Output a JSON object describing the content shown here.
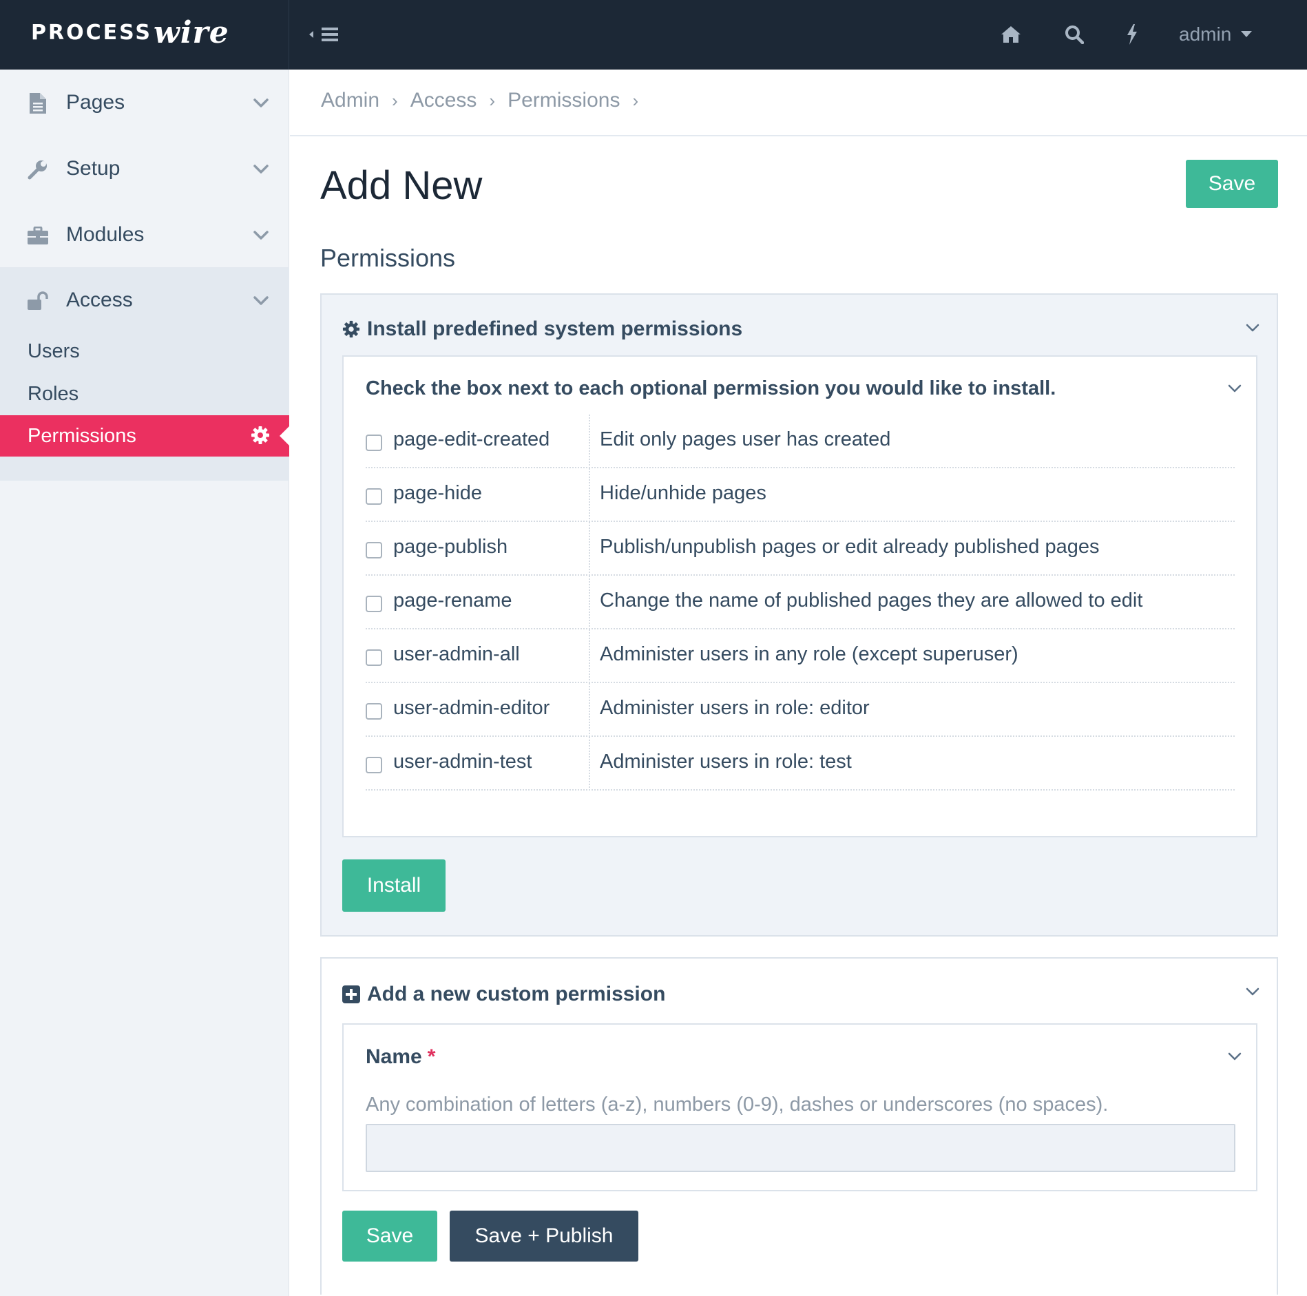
{
  "brand": {
    "logo_part1": "PROCESS",
    "logo_part2": "wire"
  },
  "topbar": {
    "toggle_icon": "sidebar-toggle-icon",
    "icons": [
      "home-icon",
      "search-icon",
      "bolt-icon"
    ],
    "user": {
      "label": "admin",
      "icon": "caret-down-icon"
    }
  },
  "sidebar": {
    "items": [
      {
        "label": "Pages",
        "icon": "file-icon"
      },
      {
        "label": "Setup",
        "icon": "wrench-icon"
      },
      {
        "label": "Modules",
        "icon": "briefcase-icon"
      },
      {
        "label": "Access",
        "icon": "unlock-icon"
      }
    ],
    "access_children": [
      {
        "label": "Users"
      },
      {
        "label": "Roles"
      },
      {
        "label": "Permissions",
        "active": true
      }
    ]
  },
  "breadcrumb": [
    "Admin",
    "Access",
    "Permissions"
  ],
  "page": {
    "title": "Add New",
    "save_label": "Save",
    "section_heading": "Permissions"
  },
  "install_fieldset": {
    "heading": "Install predefined system permissions",
    "instruction": "Check the box next to each optional permission you would like to install.",
    "rows": [
      {
        "name": "page-edit-created",
        "description": "Edit only pages user has created",
        "checked": false
      },
      {
        "name": "page-hide",
        "description": "Hide/unhide pages",
        "checked": false
      },
      {
        "name": "page-publish",
        "description": "Publish/unpublish pages or edit already published pages",
        "checked": false
      },
      {
        "name": "page-rename",
        "description": "Change the name of published pages they are allowed to edit",
        "checked": false
      },
      {
        "name": "user-admin-all",
        "description": "Administer users in any role (except superuser)",
        "checked": false
      },
      {
        "name": "user-admin-editor",
        "description": "Administer users in role: editor",
        "checked": false
      },
      {
        "name": "user-admin-test",
        "description": "Administer users in role: test",
        "checked": false
      }
    ],
    "install_label": "Install"
  },
  "custom_fieldset": {
    "heading": "Add a new custom permission",
    "name_label": "Name",
    "required_marker": "*",
    "name_description": "Any combination of letters (a-z), numbers (0-9), dashes or underscores (no spaces).",
    "name_value": "",
    "save_label": "Save",
    "save_publish_label": "Save + Publish"
  },
  "colors": {
    "topbar": "#1c2836",
    "accent_active": "#eb3060",
    "button_green": "#3eb998",
    "button_dark": "#354b60",
    "text": "#354b60"
  }
}
